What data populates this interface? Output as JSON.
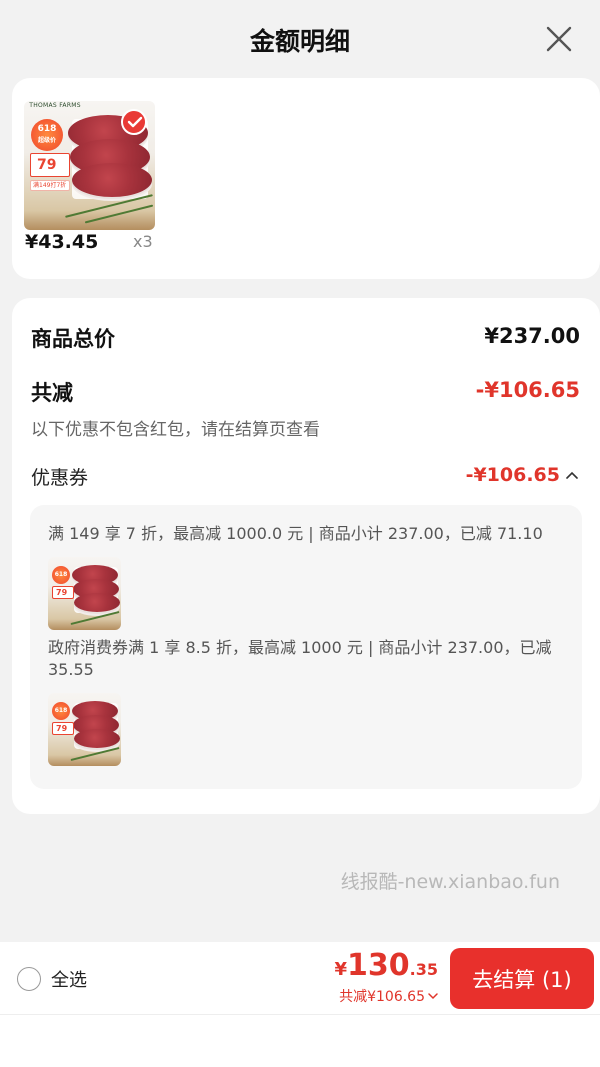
{
  "header": {
    "title": "金额明细"
  },
  "product": {
    "brand_text": "THOMAS FARMS",
    "badge_text": "618",
    "badge_sub": "超级价",
    "tag_price": "79",
    "tag_promo": "满149打7折",
    "price": "¥43.45",
    "qty": "x3"
  },
  "detail": {
    "subtotal_label": "商品总价",
    "subtotal_value": "¥237.00",
    "reduce_label": "共减",
    "reduce_value": "-¥106.65",
    "note": "以下优惠不包含红包，请在结算页查看",
    "coupon_label": "优惠券",
    "coupon_value": "-¥106.65",
    "rules": [
      {
        "text": "满 149 享 7 折，最高减 1000.0 元 | 商品小计 237.00，已减 71.10"
      },
      {
        "text": "政府消费券满 1 享 8.5 折，最高减 1000 元 | 商品小计 237.00，已减 35.55"
      }
    ]
  },
  "watermark": "线报酷-new.xianbao.fun",
  "bottom": {
    "select_all": "全选",
    "total_yen": "¥",
    "total_int": "130",
    "total_dec": ".35",
    "total_sub": "共减¥106.65",
    "checkout_label": "去结算 (1)"
  },
  "colors": {
    "accent": "#e8302c",
    "price_red": "#e0352b"
  },
  "icons": [
    "close-icon",
    "check-icon",
    "chevron-up-icon",
    "chevron-down-icon"
  ]
}
